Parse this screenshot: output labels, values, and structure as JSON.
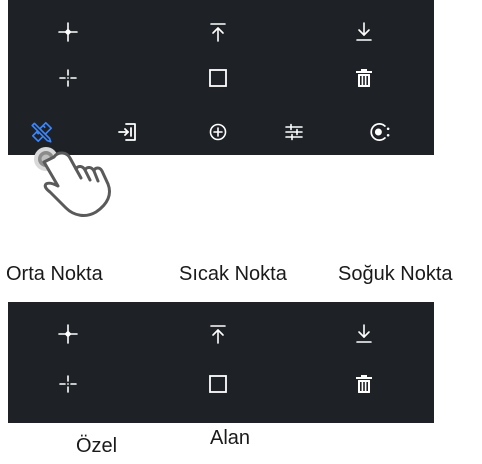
{
  "colors": {
    "panel_bg": "#1e2227",
    "icon": "#ffffff",
    "accent": "#3a86ff"
  },
  "top_toolbar": {
    "snap_icons": [
      "midpoint-snap-icon",
      "top-snap-icon",
      "bottom-snap-icon",
      "custom-snap-icon",
      "area-snap-icon",
      "delete-icon"
    ],
    "tool_icons": [
      "pencil-ruler-icon",
      "import-icon",
      "crosshair-target-icon",
      "sliders-icon",
      "settings-icon"
    ],
    "active_tool": "pencil-ruler-icon"
  },
  "gesture": {
    "icon": "tap-hand-icon"
  },
  "labels": {
    "orta_nokta": "Orta Nokta",
    "sicak_nokta": "Sıcak Nokta",
    "soguk_nokta": "Soğuk Nokta",
    "ozel": "Özel",
    "alan": "Alan"
  },
  "bottom_toolbar": {
    "snap_icons": [
      "midpoint-snap-icon",
      "top-snap-icon",
      "bottom-snap-icon",
      "custom-snap-icon",
      "area-snap-icon",
      "delete-icon"
    ]
  }
}
